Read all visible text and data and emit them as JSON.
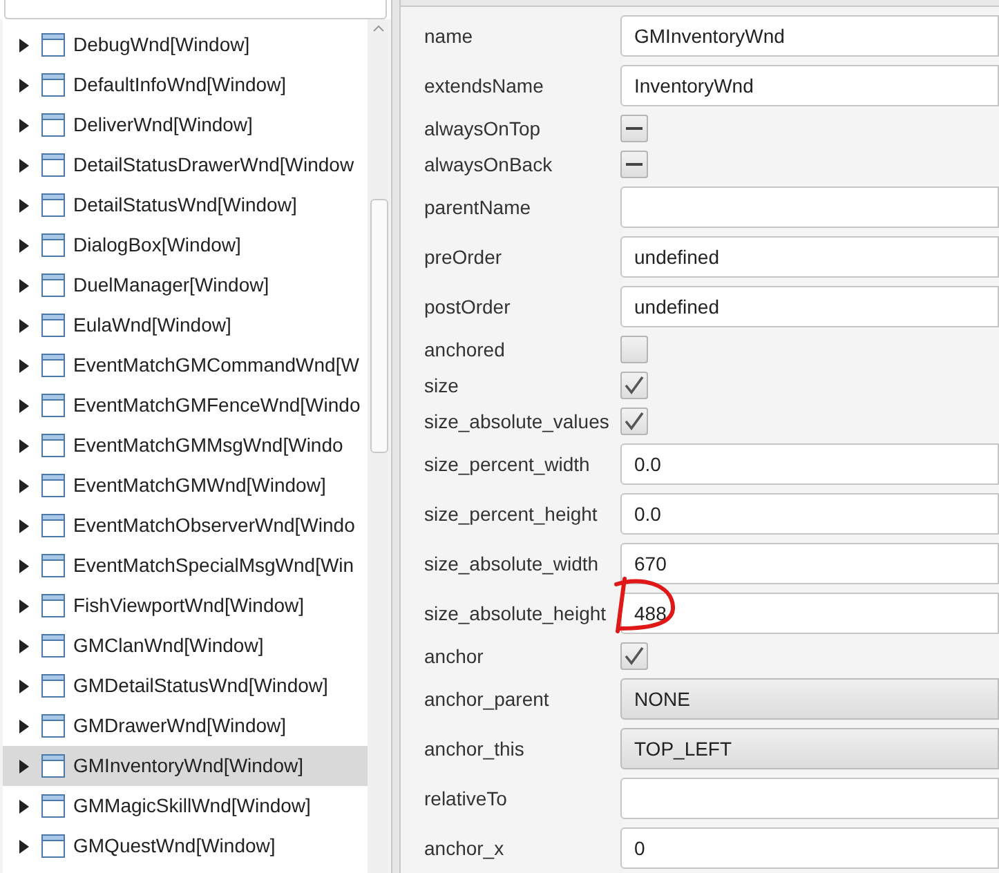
{
  "tree": {
    "items": [
      {
        "label": "DebugWnd[Window]",
        "selected": false
      },
      {
        "label": "DefaultInfoWnd[Window]",
        "selected": false
      },
      {
        "label": "DeliverWnd[Window]",
        "selected": false
      },
      {
        "label": "DetailStatusDrawerWnd[Window",
        "selected": false
      },
      {
        "label": "DetailStatusWnd[Window]",
        "selected": false
      },
      {
        "label": "DialogBox[Window]",
        "selected": false
      },
      {
        "label": "DuelManager[Window]",
        "selected": false
      },
      {
        "label": "EulaWnd[Window]",
        "selected": false
      },
      {
        "label": "EventMatchGMCommandWnd[W",
        "selected": false
      },
      {
        "label": "EventMatchGMFenceWnd[Windo",
        "selected": false
      },
      {
        "label": "EventMatchGMMsgWnd[Windo",
        "selected": false
      },
      {
        "label": "EventMatchGMWnd[Window]",
        "selected": false
      },
      {
        "label": "EventMatchObserverWnd[Windo",
        "selected": false
      },
      {
        "label": "EventMatchSpecialMsgWnd[Win",
        "selected": false
      },
      {
        "label": "FishViewportWnd[Window]",
        "selected": false
      },
      {
        "label": "GMClanWnd[Window]",
        "selected": false
      },
      {
        "label": "GMDetailStatusWnd[Window]",
        "selected": false
      },
      {
        "label": "GMDrawerWnd[Window]",
        "selected": false
      },
      {
        "label": "GMInventoryWnd[Window]",
        "selected": true
      },
      {
        "label": "GMMagicSkillWnd[Window]",
        "selected": false
      },
      {
        "label": "GMQuestWnd[Window]",
        "selected": false
      }
    ]
  },
  "properties": [
    {
      "label": "name",
      "kind": "text",
      "value": "GMInventoryWnd"
    },
    {
      "label": "extendsName",
      "kind": "text",
      "value": "InventoryWnd"
    },
    {
      "label": "alwaysOnTop",
      "kind": "checkbox",
      "indeterminate": true
    },
    {
      "label": "alwaysOnBack",
      "kind": "checkbox",
      "indeterminate": true
    },
    {
      "label": "parentName",
      "kind": "text"
    },
    {
      "label": "preOrder",
      "kind": "text",
      "value": "undefined"
    },
    {
      "label": "postOrder",
      "kind": "text",
      "value": "undefined"
    },
    {
      "label": "anchored",
      "kind": "checkbox",
      "checked": false
    },
    {
      "label": "size",
      "kind": "checkbox",
      "checked": true
    },
    {
      "label": "size_absolute_values",
      "kind": "checkbox",
      "checked": true
    },
    {
      "label": "size_percent_width",
      "kind": "text",
      "value": "0.0"
    },
    {
      "label": "size_percent_height",
      "kind": "text",
      "value": "0.0"
    },
    {
      "label": "size_absolute_width",
      "kind": "text",
      "value": "670"
    },
    {
      "label": "size_absolute_height",
      "kind": "text",
      "value": "488",
      "annotated": true
    },
    {
      "label": "anchor",
      "kind": "checkbox",
      "checked": true
    },
    {
      "label": "anchor_parent",
      "kind": "combo",
      "value": "NONE"
    },
    {
      "label": "anchor_this",
      "kind": "combo",
      "value": "TOP_LEFT"
    },
    {
      "label": "relativeTo",
      "kind": "text"
    },
    {
      "label": "anchor_x",
      "kind": "text",
      "value": "0"
    }
  ]
}
